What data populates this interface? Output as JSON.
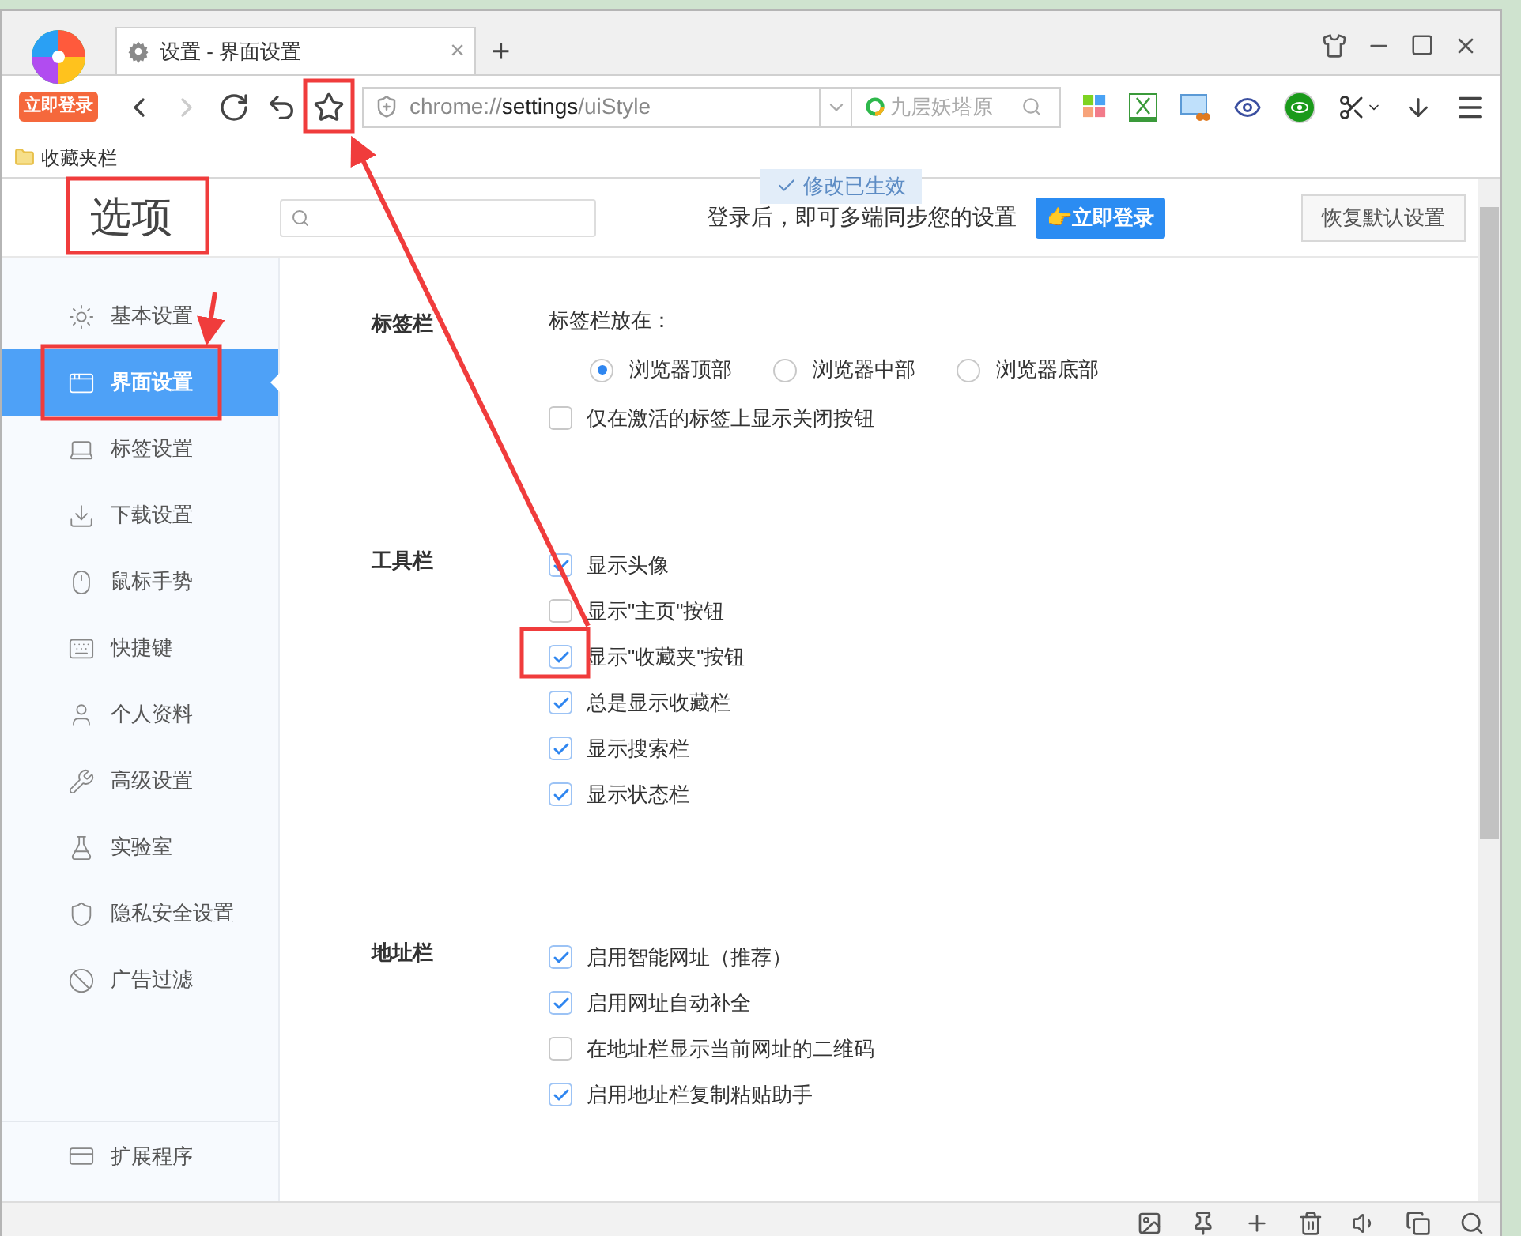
{
  "browser": {
    "login_badge": "立即登录",
    "tab": {
      "title": "设置 - 界面设置",
      "close": "×"
    },
    "new_tab": "+",
    "nav": [
      {
        "kind": "back",
        "disabled": false
      },
      {
        "kind": "forward",
        "disabled": true
      },
      {
        "kind": "reload",
        "disabled": false
      },
      {
        "kind": "undo",
        "disabled": false
      },
      {
        "kind": "star",
        "disabled": false
      }
    ],
    "address": [
      {
        "text": "chrome://",
        "emphasis": false
      },
      {
        "text": "settings",
        "emphasis": true
      },
      {
        "text": "/uiStyle",
        "emphasis": false
      }
    ],
    "search": {
      "placeholder": "九层妖塔原"
    },
    "bookmarks": [
      {
        "label": "收藏夹栏"
      }
    ]
  },
  "header": {
    "title": "选项",
    "toast": "修改已生效",
    "sync_text": "登录后，即可多端同步您的设置",
    "login_button": "👉立即登录",
    "reset_button": "恢复默认设置"
  },
  "sidebar": {
    "items": [
      {
        "label": "基本设置",
        "selected": false
      },
      {
        "label": "界面设置",
        "selected": true
      },
      {
        "label": "标签设置",
        "selected": false
      },
      {
        "label": "下载设置",
        "selected": false
      },
      {
        "label": "鼠标手势",
        "selected": false
      },
      {
        "label": "快捷键",
        "selected": false
      },
      {
        "label": "个人资料",
        "selected": false
      },
      {
        "label": "高级设置",
        "selected": false
      },
      {
        "label": "实验室",
        "selected": false
      },
      {
        "label": "隐私安全设置",
        "selected": false
      },
      {
        "label": "广告过滤",
        "selected": false
      }
    ],
    "footer": "扩展程序"
  },
  "sections": [
    {
      "title": "标签栏",
      "rows": [
        {
          "kind": "prompt",
          "label": "标签栏放在："
        },
        {
          "kind": "radios",
          "options": [
            {
              "label": "浏览器顶部",
              "selected": true
            },
            {
              "label": "浏览器中部",
              "selected": false
            },
            {
              "label": "浏览器底部",
              "selected": false
            }
          ]
        },
        {
          "kind": "checkbox",
          "label": "仅在激活的标签上显示关闭按钮",
          "checked": false
        }
      ]
    },
    {
      "title": "工具栏",
      "rows": [
        {
          "kind": "checkbox",
          "label": "显示头像",
          "checked": true
        },
        {
          "kind": "checkbox",
          "label": "显示\"主页\"按钮",
          "checked": false
        },
        {
          "kind": "checkbox",
          "label": "显示\"收藏夹\"按钮",
          "checked": true
        },
        {
          "kind": "checkbox",
          "label": "总是显示收藏栏",
          "checked": true
        },
        {
          "kind": "checkbox",
          "label": "显示搜索栏",
          "checked": true
        },
        {
          "kind": "checkbox",
          "label": "显示状态栏",
          "checked": true
        }
      ]
    },
    {
      "title": "地址栏",
      "rows": [
        {
          "kind": "checkbox",
          "label": "启用智能网址（推荐）",
          "checked": true
        },
        {
          "kind": "checkbox",
          "label": "启用网址自动补全",
          "checked": true
        },
        {
          "kind": "checkbox",
          "label": "在地址栏显示当前网址的二维码",
          "checked": false
        },
        {
          "kind": "checkbox",
          "label": "启用地址栏复制粘贴助手",
          "checked": true
        }
      ]
    }
  ]
}
